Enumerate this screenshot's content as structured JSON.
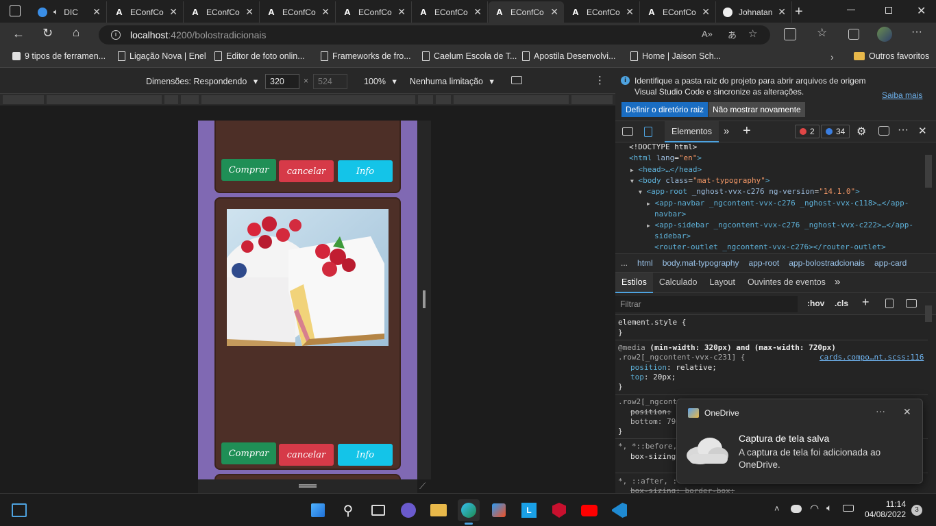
{
  "tabs": [
    {
      "title": "DIC",
      "icon": "edge-collections-icon"
    },
    {
      "title": "EConfCo",
      "icon": "angular-icon"
    },
    {
      "title": "EConfCo",
      "icon": "angular-icon"
    },
    {
      "title": "EConfCo",
      "icon": "angular-icon"
    },
    {
      "title": "EConfCo",
      "icon": "angular-icon"
    },
    {
      "title": "EConfCo",
      "icon": "angular-icon"
    },
    {
      "title": "EConfCo",
      "icon": "angular-icon"
    },
    {
      "title": "EConfCo",
      "icon": "angular-icon"
    },
    {
      "title": "EConfCo",
      "icon": "angular-icon"
    },
    {
      "title": "Johnatan",
      "icon": "github-icon"
    }
  ],
  "address": {
    "host": "localhost",
    "path": ":4200/bolostradicionais"
  },
  "favorites": [
    {
      "label": "9 tipos de ferramen..."
    },
    {
      "label": "Ligação Nova | Enel"
    },
    {
      "label": "Editor de foto onlin..."
    },
    {
      "label": "Frameworks de fro..."
    },
    {
      "label": "Caelum Escola de T..."
    },
    {
      "label": "Apostila Desenvolvi..."
    },
    {
      "label": "Home | Jaison Sch..."
    }
  ],
  "favorites_other": "Outros favoritos",
  "device_toolbar": {
    "dimensions": "Dimensões: Respondendo",
    "width": "320",
    "height": "524",
    "zoom": "100%",
    "throttle": "Nenhuma limitação"
  },
  "cards": [
    {
      "buttons": {
        "buy": "Comprar",
        "cancel": "cancelar",
        "info": "Info"
      }
    },
    {
      "buttons": {
        "buy": "Comprar",
        "cancel": "cancelar",
        "info": "Info"
      }
    }
  ],
  "infobar": {
    "message": "Identifique a pasta raiz do projeto para abrir arquivos de origem Visual Studio Code e sincronize as alterações.",
    "learn_more": "Saiba mais",
    "set_root": "Definir o diretório raiz",
    "dont_show": "Não mostrar novamente"
  },
  "devtools_tabs": {
    "elements": "Elementos",
    "errors": "2",
    "warnings": "34"
  },
  "dom": {
    "l1": "<!DOCTYPE html>",
    "l2_tag": "<html",
    "l2_attr": "lang",
    "l2_val": "\"en\"",
    "l3": "<head>…</head>",
    "l4_attr": "class",
    "l4_val": "\"mat-typography\"",
    "l5_a": "<app-root",
    "l5_b": "_nghost-vvx-c276",
    "l5_c": "ng-version",
    "l5_d": "\"14.1.0\"",
    "l6a": "<app-navbar _ngcontent-vvx-c276 _nghost-vvx-c118>…</app-",
    "l6b": "navbar>",
    "l7a": "<app-sidebar _ngcontent-vvx-c276 _nghost-vvx-c222>…</app-",
    "l7b": "sidebar>",
    "l8": "<router-outlet _ngcontent-vvx-c276></router-outlet>"
  },
  "breadcrumbs": [
    "...",
    "html",
    "body.mat-typography",
    "app-root",
    "app-bolostradcionais",
    "app-card"
  ],
  "style_tabs": [
    "Estilos",
    "Calculado",
    "Layout",
    "Ouvintes de eventos"
  ],
  "filter": {
    "placeholder": "Filtrar",
    "hov": ":hov",
    "cls": ".cls"
  },
  "styles": {
    "element_style": "element.style {",
    "close": "}",
    "media": "@media",
    "media_q": "(min-width: 320px) and (max-width: 720px)",
    "rule1": ".row2[_ngcontent-vvx-c231] {",
    "rule1_src": "cards.compo…nt.scss:116",
    "position": "position",
    "relative": "relative;",
    "top": "top",
    "top_val": "20px;",
    "rule2": ".row2[_ngcont",
    "position2": "position:",
    "bottom": "bottom: 79",
    "rule3": "*, *::before,",
    "boxsizing": "box-sizing",
    "rule4": "*, ::after, :",
    "boxsizing2": "box-sizing: border-box;"
  },
  "toast": {
    "app": "OneDrive",
    "title": "Captura de tela salva",
    "body": "A captura de tela foi adicionada ao OneDrive."
  },
  "clock": {
    "time": "11:14",
    "date": "04/08/2022",
    "notifications": "3"
  }
}
